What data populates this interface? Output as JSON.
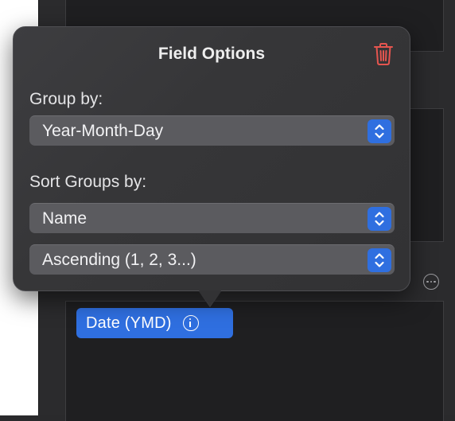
{
  "popover": {
    "title": "Field Options",
    "group_by_label": "Group by:",
    "group_by_value": "Year-Month-Day",
    "sort_groups_label": "Sort Groups by:",
    "sort_by_value": "Name",
    "sort_order_value": "Ascending (1, 2, 3...)"
  },
  "token": {
    "label": "Date (YMD)"
  },
  "icons": {
    "trash": "trash-icon",
    "info": "info-icon",
    "more": "ellipsis-circle-icon",
    "stepper": "chevron-up-down-icon"
  },
  "colors": {
    "accent": "#2f6fe0",
    "destructive": "#e5554f"
  }
}
